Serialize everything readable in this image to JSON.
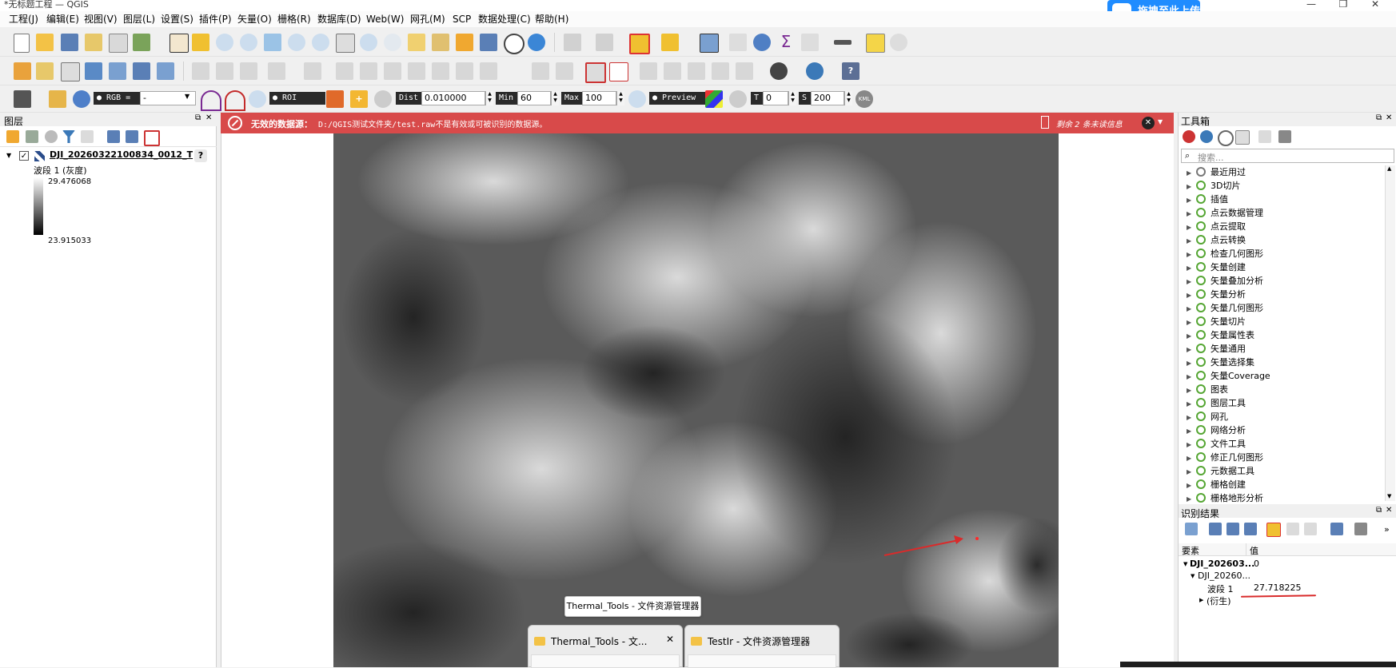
{
  "window": {
    "title": "*无标题工程 — QGIS",
    "upload_label": "拖拽至此上传",
    "minimize": "—",
    "maximize": "❐",
    "close": "✕"
  },
  "menubar": [
    "工程(J)",
    "编辑(E)",
    "视图(V)",
    "图层(L)",
    "设置(S)",
    "插件(P)",
    "矢量(O)",
    "栅格(R)",
    "数据库(D)",
    "Web(W)",
    "网孔(M)",
    "SCP",
    "数据处理(C)",
    "帮助(H)"
  ],
  "scp_toolbar": {
    "rgb_label": "● RGB =",
    "rgb_value": "-",
    "roi_label": "● ROI",
    "dist_label": "Dist",
    "dist_value": "0.010000",
    "min_label": "Min",
    "min_value": "60",
    "max_label": "Max",
    "max_value": "100",
    "preview_label": "● Preview",
    "t_label": "T",
    "t_value": "0",
    "s_label": "S",
    "s_value": "200",
    "kml_label": "KML"
  },
  "layers": {
    "title": "图层",
    "layer_name": "DJI_20260322100834_0012_T",
    "band_label": "波段 1 (灰度)",
    "max_value": "29.476068",
    "min_value": "23.915033",
    "help": "?"
  },
  "message": {
    "bold": "无效的数据源：",
    "text": "D:/QGIS测试文件夹/test.raw不是有效或可被识别的数据源。",
    "remaining": "剩余 2 条未读信息"
  },
  "toolbox": {
    "title": "工具箱",
    "search_placeholder": "搜索...",
    "items": [
      "最近用过",
      "3D切片",
      "插值",
      "点云数据管理",
      "点云提取",
      "点云转换",
      "检查几何图形",
      "矢量创建",
      "矢量叠加分析",
      "矢量分析",
      "矢量几何图形",
      "矢量切片",
      "矢量属性表",
      "矢量通用",
      "矢量选择集",
      "矢量Coverage",
      "图表",
      "图层工具",
      "网孔",
      "网络分析",
      "文件工具",
      "修正几何图形",
      "元数据工具",
      "栅格创建",
      "栅格地形分析"
    ]
  },
  "identify": {
    "title": "识别结果",
    "col_feature": "要素",
    "col_value": "值",
    "row1_name": "DJI_202603...",
    "row1_value": "0",
    "row2_name": "DJI_20260...",
    "band_name": "波段 1",
    "band_value": "27.718225",
    "derived": "(衍生)"
  },
  "taskbar": {
    "tooltip": "Thermal_Tools - 文件资源管理器",
    "card1": "Thermal_Tools - 文...",
    "card2": "TestIr - 文件资源管理器"
  }
}
